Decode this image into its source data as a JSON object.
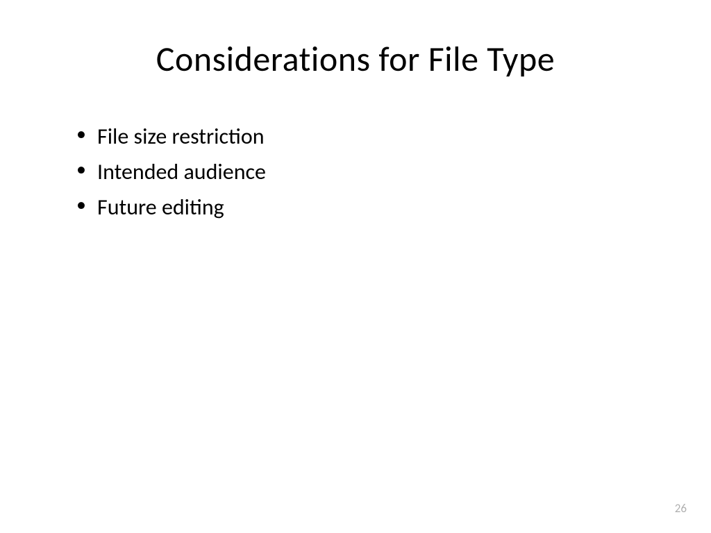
{
  "slide": {
    "title": "Considerations for File Type",
    "bullets": [
      "File size restriction",
      "Intended audience",
      "Future editing"
    ],
    "page_number": "26"
  }
}
